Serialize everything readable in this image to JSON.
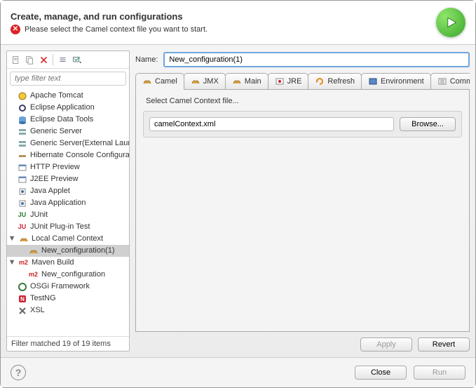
{
  "header": {
    "title": "Create, manage, and run configurations",
    "message": "Please select the Camel context file you want to start."
  },
  "toolbar": {
    "new": "New",
    "duplicate": "Duplicate",
    "delete": "Delete",
    "collapse": "Collapse All",
    "expand": "Expand All"
  },
  "filter": {
    "placeholder": "type filter text"
  },
  "tree": [
    {
      "label": "Apache Tomcat",
      "icon": "tomcat"
    },
    {
      "label": "Eclipse Application",
      "icon": "eclipse"
    },
    {
      "label": "Eclipse Data Tools",
      "icon": "datatools"
    },
    {
      "label": "Generic Server",
      "icon": "server"
    },
    {
      "label": "Generic Server(External Launch)",
      "icon": "server"
    },
    {
      "label": "Hibernate Console Configuration",
      "icon": "hibernate"
    },
    {
      "label": "HTTP Preview",
      "icon": "http"
    },
    {
      "label": "J2EE Preview",
      "icon": "j2ee"
    },
    {
      "label": "Java Applet",
      "icon": "java"
    },
    {
      "label": "Java Application",
      "icon": "java"
    },
    {
      "label": "JUnit",
      "icon": "junit"
    },
    {
      "label": "JUnit Plug-in Test",
      "icon": "junit-plugin"
    },
    {
      "label": "Local Camel Context",
      "icon": "camel",
      "expanded": true,
      "children": [
        {
          "label": "New_configuration(1)",
          "icon": "camel",
          "selected": true
        }
      ]
    },
    {
      "label": "Maven Build",
      "icon": "m2",
      "expanded": true,
      "children": [
        {
          "label": "New_configuration",
          "icon": "m2"
        }
      ]
    },
    {
      "label": "OSGi Framework",
      "icon": "osgi"
    },
    {
      "label": "TestNG",
      "icon": "testng"
    },
    {
      "label": "XSL",
      "icon": "xsl"
    }
  ],
  "status": "Filter matched 19 of 19 items",
  "main": {
    "name_label": "Name:",
    "name_value": "New_configuration(1)",
    "tabs": [
      {
        "label": "Camel",
        "icon": "camel",
        "active": true
      },
      {
        "label": "JMX",
        "icon": "camel"
      },
      {
        "label": "Main",
        "icon": "camel"
      },
      {
        "label": "JRE",
        "icon": "jre"
      },
      {
        "label": "Refresh",
        "icon": "refresh"
      },
      {
        "label": "Environment",
        "icon": "env"
      },
      {
        "label": "Common",
        "icon": "common"
      }
    ],
    "section_label": "Select Camel Context file...",
    "context_file": "camelContext.xml",
    "browse": "Browse...",
    "apply": "Apply",
    "revert": "Revert"
  },
  "footer": {
    "close": "Close",
    "run": "Run"
  }
}
